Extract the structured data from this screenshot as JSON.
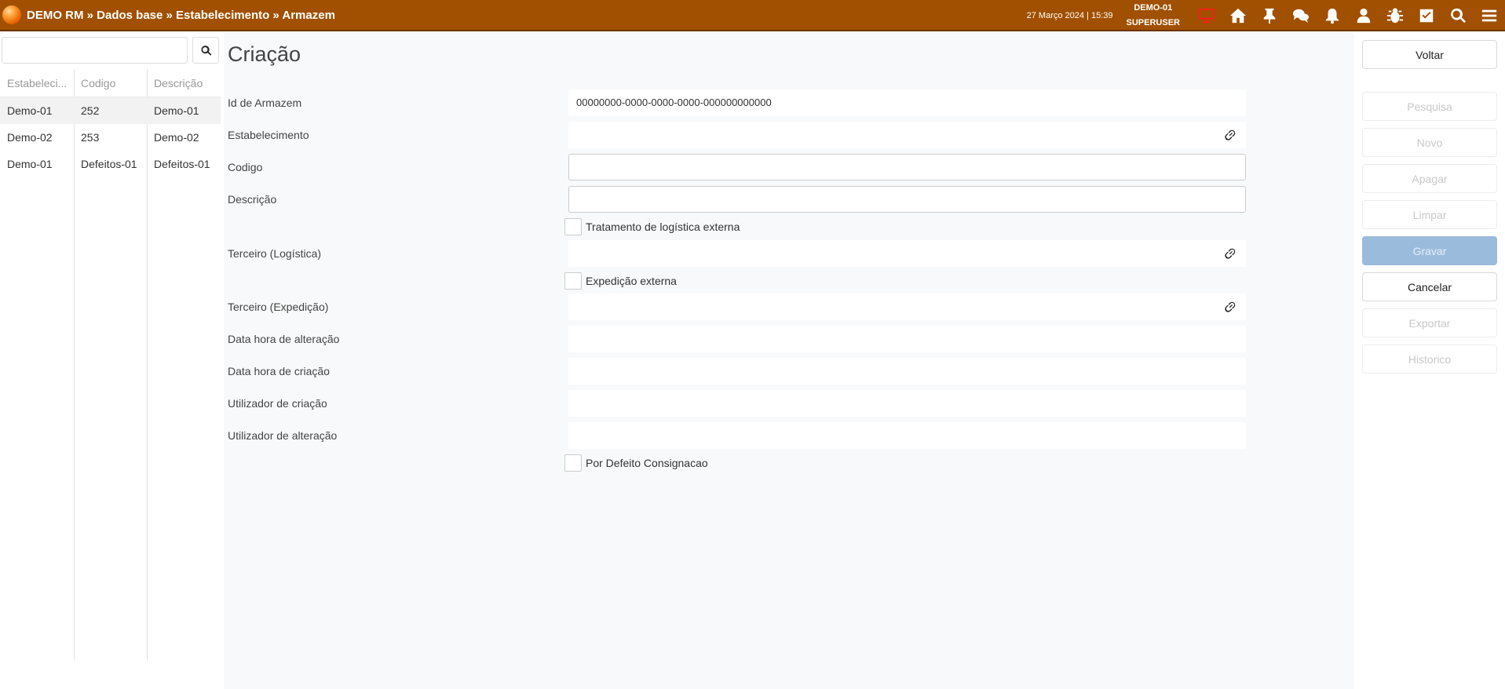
{
  "header": {
    "breadcrumb": "DEMO RM » Dados base » Estabelecimento » Armazem",
    "datetime": "27 Março 2024 | 15:39",
    "establishment": "DEMO-01",
    "user": "SUPERUSER",
    "colors": {
      "bar": "#a05000",
      "screen_icon": "#ff0000"
    },
    "icons": [
      "screen-icon",
      "home-icon",
      "pin-icon",
      "chat-icon",
      "bell-icon",
      "user-icon",
      "bug-icon",
      "check-icon",
      "search-icon",
      "menu-icon"
    ]
  },
  "list": {
    "search_placeholder": "",
    "columns": [
      "Estabeleci...",
      "Codigo",
      "Descrição"
    ],
    "rows": [
      [
        "Demo-01",
        "252",
        "Demo-01"
      ],
      [
        "Demo-02",
        "253",
        "Demo-02"
      ],
      [
        "Demo-01",
        "Defeitos-01",
        "Defeitos-01"
      ]
    ]
  },
  "form": {
    "title": "Criação",
    "fields": {
      "id_armazem": {
        "label": "Id de Armazem",
        "value": "00000000-0000-0000-0000-000000000000"
      },
      "estabelecimento": {
        "label": "Estabelecimento",
        "value": ""
      },
      "codigo": {
        "label": "Codigo",
        "value": ""
      },
      "descricao": {
        "label": "Descrição",
        "value": ""
      },
      "tratamento_logistica": {
        "label": "Tratamento de logística externa"
      },
      "terceiro_logistica": {
        "label": "Terceiro (Logística)",
        "value": ""
      },
      "expedicao_externa": {
        "label": "Expedição externa"
      },
      "terceiro_expedicao": {
        "label": "Terceiro (Expedição)",
        "value": ""
      },
      "data_alteracao": {
        "label": "Data hora de alteração",
        "value": ""
      },
      "data_criacao": {
        "label": "Data hora de criação",
        "value": ""
      },
      "utilizador_criacao": {
        "label": "Utilizador de criação",
        "value": ""
      },
      "utilizador_alteracao": {
        "label": "Utilizador de alteração",
        "value": ""
      },
      "por_defeito_consignacao": {
        "label": "Por Defeito Consignacao"
      }
    }
  },
  "actions": {
    "voltar": "Voltar",
    "pesquisa": "Pesquisa",
    "novo": "Novo",
    "apagar": "Apagar",
    "limpar": "Limpar",
    "gravar": "Gravar",
    "cancelar": "Cancelar",
    "exportar": "Exportar",
    "historico": "Historico"
  }
}
